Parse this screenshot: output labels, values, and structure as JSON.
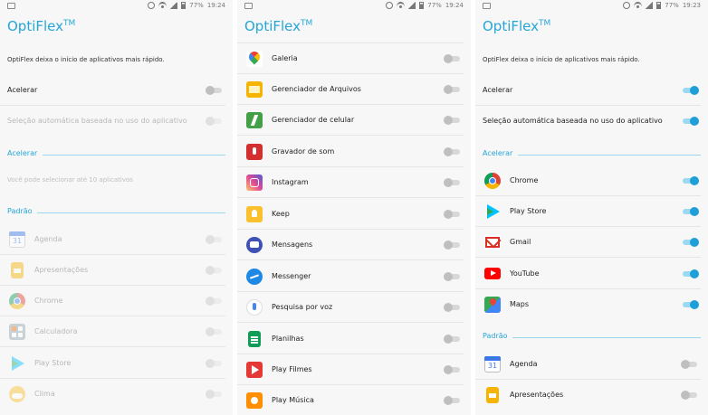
{
  "status": {
    "battery": "77%",
    "time_p1": "19:24",
    "time_p2": "19:24",
    "time_p3": "19:23"
  },
  "title": "OptiFlex",
  "title_sup": "TM",
  "description": "OptiFlex deixa o início de aplicativos mais rápido.",
  "settings": {
    "accelerate": "Acelerar",
    "auto": "Seleção automática baseada no uso do aplicativo"
  },
  "sections": {
    "accelerate": "Acelerar",
    "default": "Padrão"
  },
  "hint": "Você pode selecionar até 10 aplicativos",
  "panel1_apps": [
    {
      "label": "Agenda",
      "icon": "calendar-icon"
    },
    {
      "label": "Apresentações",
      "icon": "slides-icon"
    },
    {
      "label": "Chrome",
      "icon": "chrome-icon"
    },
    {
      "label": "Calculadora",
      "icon": "calculator-icon"
    },
    {
      "label": "Play Store",
      "icon": "play-store-icon"
    },
    {
      "label": "Clima",
      "icon": "weather-icon"
    }
  ],
  "panel2_apps": [
    {
      "label": "Galeria",
      "icon": "gallery-icon"
    },
    {
      "label": "Gerenciador de Arquivos",
      "icon": "file-manager-icon"
    },
    {
      "label": "Gerenciador de celular",
      "icon": "phone-manager-icon"
    },
    {
      "label": "Gravador de som",
      "icon": "sound-recorder-icon"
    },
    {
      "label": "Instagram",
      "icon": "instagram-icon"
    },
    {
      "label": "Keep",
      "icon": "keep-icon"
    },
    {
      "label": "Mensagens",
      "icon": "messages-icon"
    },
    {
      "label": "Messenger",
      "icon": "messenger-icon"
    },
    {
      "label": "Pesquisa por voz",
      "icon": "voice-search-icon"
    },
    {
      "label": "Planilhas",
      "icon": "sheets-icon"
    },
    {
      "label": "Play Filmes",
      "icon": "play-movies-icon"
    },
    {
      "label": "Play Música",
      "icon": "play-music-icon"
    }
  ],
  "panel3_accel_apps": [
    {
      "label": "Chrome",
      "icon": "chrome-icon"
    },
    {
      "label": "Play Store",
      "icon": "play-store-icon"
    },
    {
      "label": "Gmail",
      "icon": "gmail-icon"
    },
    {
      "label": "YouTube",
      "icon": "youtube-icon"
    },
    {
      "label": "Maps",
      "icon": "maps-icon"
    }
  ],
  "panel3_default_apps": [
    {
      "label": "Agenda",
      "icon": "calendar-icon"
    },
    {
      "label": "Apresentações",
      "icon": "slides-icon"
    }
  ],
  "calendar_day": "31",
  "colors": {
    "accent": "#25a6d8",
    "toggle_on": "#1f9fd8"
  }
}
